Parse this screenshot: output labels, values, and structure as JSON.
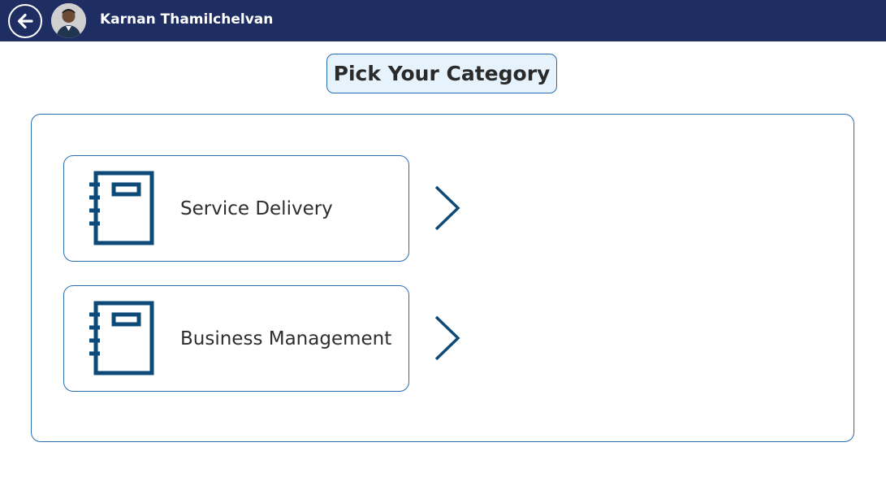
{
  "header": {
    "user_name": "Karnan Thamilchelvan",
    "back_icon": "back-arrow-icon",
    "avatar_icon": "user-avatar",
    "background": "#1e2d62"
  },
  "page": {
    "title": "Pick Your Category"
  },
  "categories": [
    {
      "label": "Service Delivery",
      "icon": "notebook-icon",
      "action_icon": "chevron-right-icon"
    },
    {
      "label": "Business Management",
      "icon": "notebook-icon",
      "action_icon": "chevron-right-icon"
    }
  ],
  "colors": {
    "accent": "#2b6cb0",
    "icon": "#0e4a78",
    "title_bg": "#e6f2fc"
  }
}
